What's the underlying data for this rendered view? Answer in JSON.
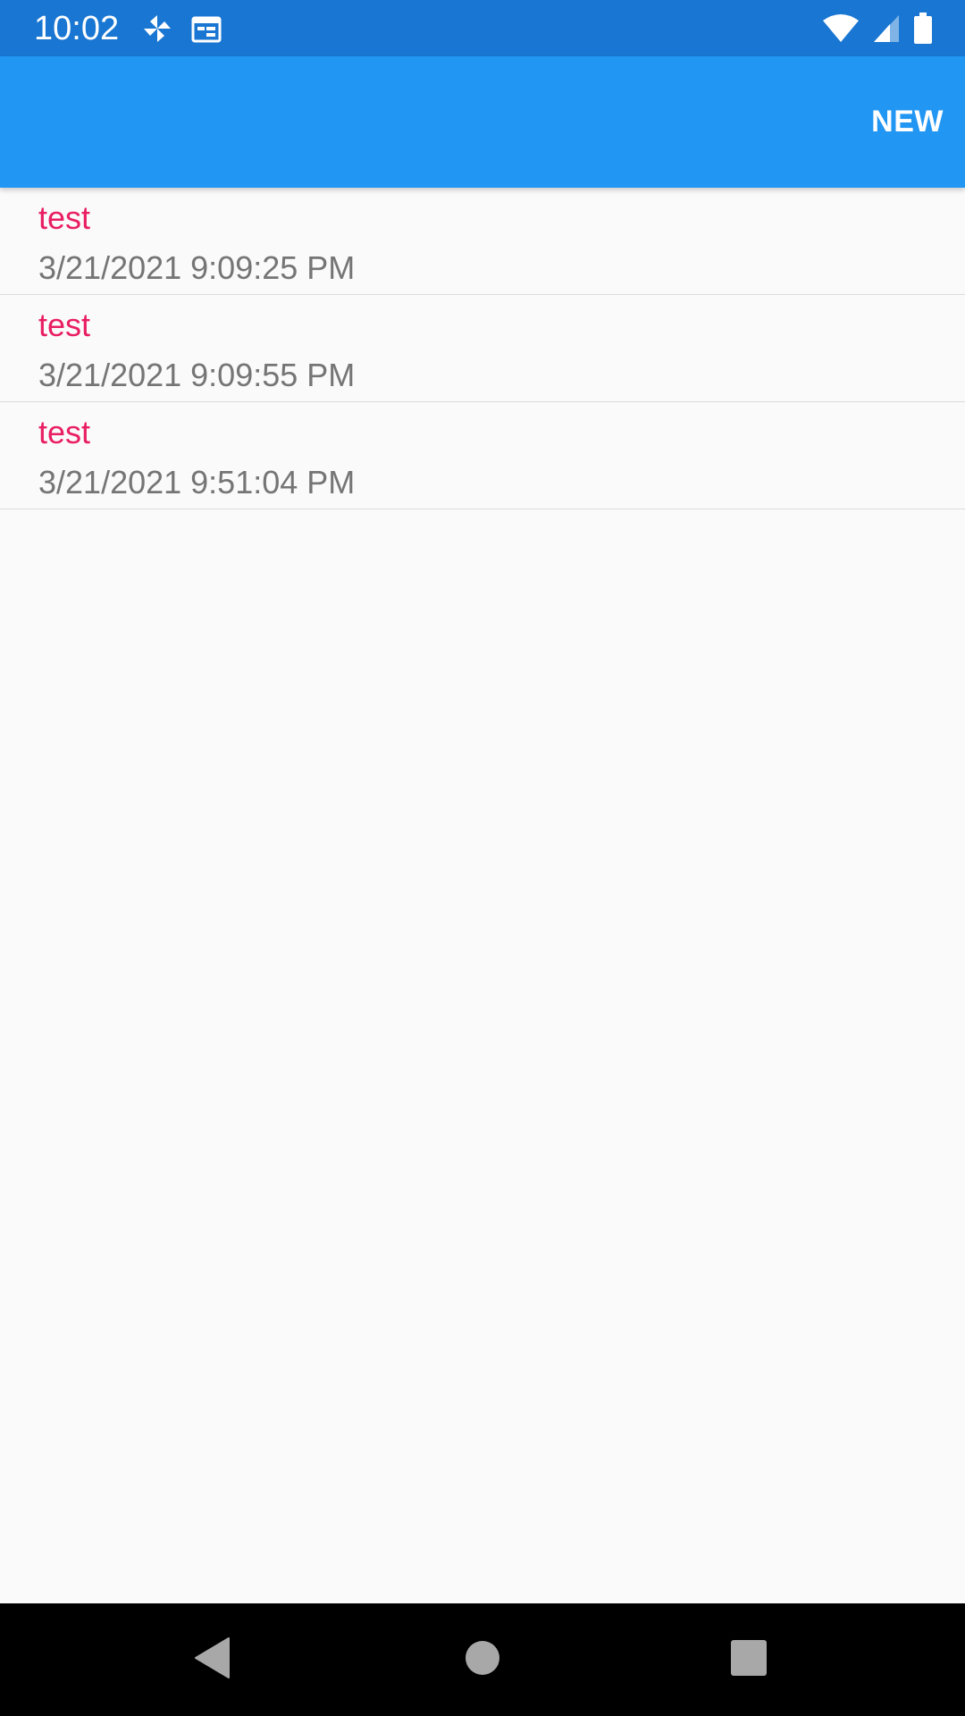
{
  "status_bar": {
    "time": "10:02",
    "left_icons": [
      "pinwheel-icon",
      "calendar-icon"
    ],
    "right_icons": [
      "wifi-icon",
      "signal-icon",
      "battery-icon"
    ],
    "background": "#1976d2"
  },
  "app_bar": {
    "action_label": "NEW",
    "background": "#2196f3"
  },
  "list": {
    "items": [
      {
        "title": "test",
        "date": "3/21/2021 9:09:25 PM"
      },
      {
        "title": "test",
        "date": "3/21/2021 9:09:55 PM"
      },
      {
        "title": "test",
        "date": "3/21/2021 9:51:04 PM"
      }
    ],
    "title_color": "#e91e63",
    "date_color": "#757575"
  },
  "nav_bar": {
    "buttons": [
      "back-icon",
      "home-icon",
      "recents-icon"
    ]
  }
}
